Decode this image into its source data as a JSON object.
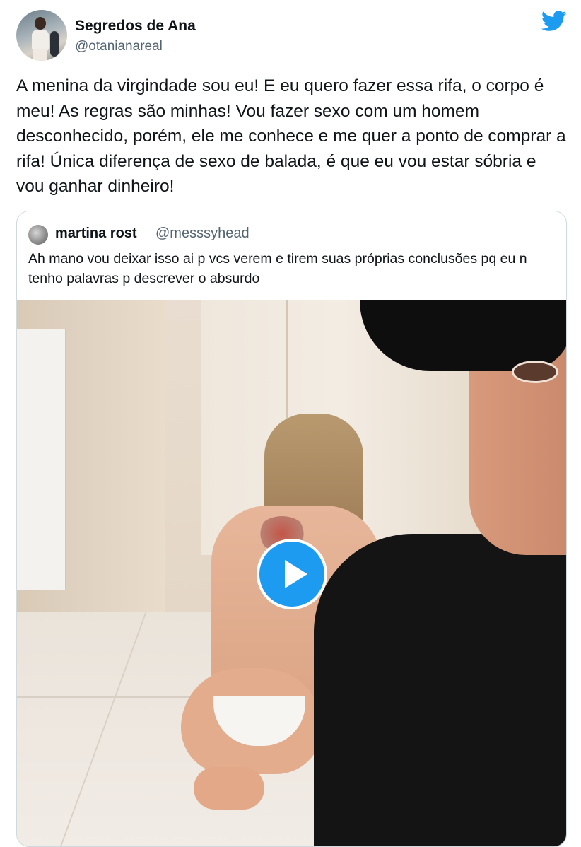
{
  "tweet": {
    "author": {
      "display_name": "Segredos de Ana",
      "handle": "@otanianareal",
      "avatar_icon": "profile-photo"
    },
    "brand_icon": "twitter-bird-icon",
    "brand_color": "#1d9bf0",
    "text": "A menina da virgindade sou eu! E eu quero fazer essa rifa, o corpo é meu! As regras são minhas! Vou fazer sexo com um homem desconhecido, porém, ele me conhece e me quer a ponto de comprar a rifa! Única diferença de sexo de balada, é que eu vou estar sóbria e vou ganhar dinheiro!"
  },
  "quote": {
    "author": {
      "display_name": "martina rost",
      "handle": "@messsyhead",
      "avatar_icon": "profile-photo"
    },
    "text": "Ah mano vou deixar isso ai p vcs verem e tirem suas próprias conclusões pq eu n tenho palavras p descrever o absurdo",
    "media": {
      "type": "video",
      "play_icon": "play-icon"
    }
  }
}
